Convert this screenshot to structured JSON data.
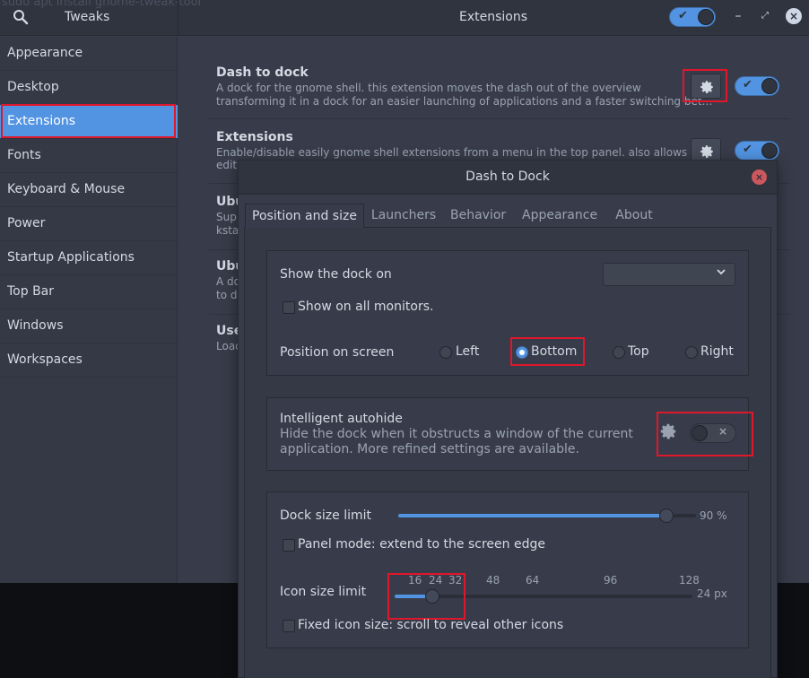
{
  "header": {
    "ghost_text": "sudo apt install gnome-tweak-tool",
    "app_title": "Tweaks",
    "window_title": "Extensions",
    "global_switch_on": true,
    "minimize_glyph": "–",
    "maximize_glyph": "⤢",
    "close_glyph": "×",
    "switch_check": "✔"
  },
  "sidebar": {
    "items": [
      {
        "label": "Appearance"
      },
      {
        "label": "Desktop"
      },
      {
        "label": "Extensions",
        "selected": true
      },
      {
        "label": "Fonts"
      },
      {
        "label": "Keyboard & Mouse"
      },
      {
        "label": "Power"
      },
      {
        "label": "Startup Applications"
      },
      {
        "label": "Top Bar"
      },
      {
        "label": "Windows"
      },
      {
        "label": "Workspaces"
      }
    ]
  },
  "extensions": [
    {
      "title": "Dash to dock",
      "desc1": "A dock for the gnome shell. this extension moves the dash out of the overview",
      "desc2": "transforming it in a dock for an easier launching of applications and a faster switching bet…",
      "enabled": true
    },
    {
      "title": "Extensions",
      "desc1": "Enable/disable easily gnome shell extensions from a menu in the top panel. also allows to",
      "desc2": "edit",
      "enabled": true
    },
    {
      "title": "Ubu",
      "desc1": "Supp",
      "desc2": "kstat"
    },
    {
      "title": "Ubu",
      "desc1": "A do",
      "desc2": "to de"
    },
    {
      "title": "Use",
      "desc1": "Loac",
      "desc2": ""
    }
  ],
  "dialog": {
    "title": "Dash to Dock",
    "close_glyph": "×",
    "tabs": [
      {
        "label": "Position and size",
        "active": true
      },
      {
        "label": "Launchers"
      },
      {
        "label": "Behavior"
      },
      {
        "label": "Appearance"
      },
      {
        "label": "About"
      }
    ],
    "show_dock_on": {
      "label": "Show the dock on",
      "value": ""
    },
    "show_all_monitors": {
      "label": "Show on all monitors.",
      "checked": false
    },
    "position": {
      "label": "Position on screen",
      "options": [
        "Left",
        "Bottom",
        "Top",
        "Right"
      ],
      "selected": "Bottom"
    },
    "autohide": {
      "title": "Intelligent autohide",
      "desc1": "Hide the dock when it obstructs a window of the current",
      "desc2": "application. More refined settings are available.",
      "enabled": false,
      "switch_x": "×"
    },
    "dock_size": {
      "label": "Dock size limit",
      "value": 0.9,
      "display": "90 %"
    },
    "panel_mode": {
      "label": "Panel mode: extend to the screen edge",
      "checked": false
    },
    "icon_size": {
      "label": "Icon size limit",
      "marks": [
        "16",
        "24",
        "32",
        "48",
        "64",
        "96",
        "128"
      ],
      "value": 24,
      "display": "24 px"
    },
    "fixed_icon": {
      "label": "Fixed icon size: scroll to reveal other icons",
      "checked": false
    }
  },
  "colors": {
    "accent": "#5294e2",
    "window_bg": "#383c4a",
    "header_bg": "#2f343f",
    "highlight_red": "#e0162b"
  }
}
